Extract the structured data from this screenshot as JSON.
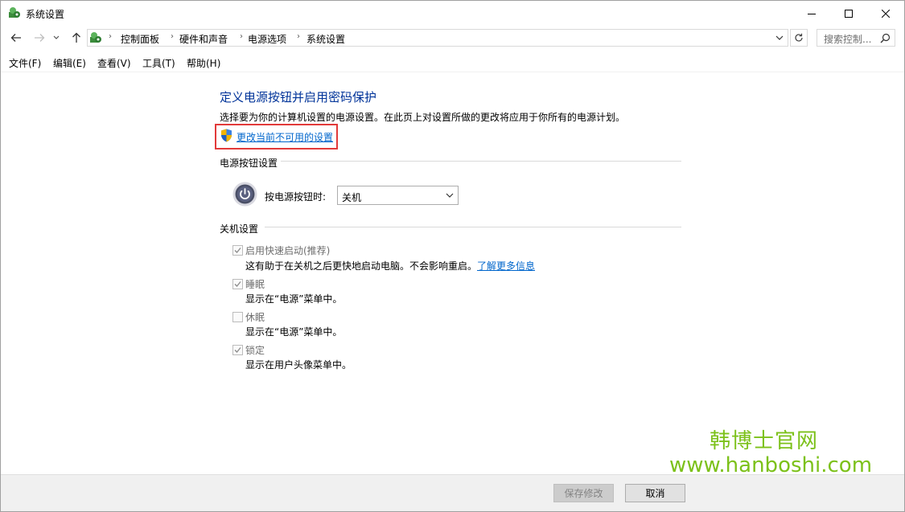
{
  "window": {
    "title": "系统设置"
  },
  "breadcrumb": [
    "控制面板",
    "硬件和声音",
    "电源选项",
    "系统设置"
  ],
  "search": {
    "placeholder": "搜索控制..."
  },
  "menu": [
    "文件(F)",
    "编辑(E)",
    "查看(V)",
    "工具(T)",
    "帮助(H)"
  ],
  "main": {
    "heading": "定义电源按钮并启用密码保护",
    "description": "选择要为你的计算机设置的电源设置。在此页上对设置所做的更改将应用于你所有的电源计划。",
    "change_link": "更改当前不可用的设置",
    "power_section": "电源按钮设置",
    "power_label": "按电源按钮时:",
    "power_value": "关机",
    "shutdown_section": "关机设置",
    "options": [
      {
        "label": "启用快速启动(推荐)",
        "desc": "这有助于在关机之后更快地启动电脑。不会影响重启。",
        "checked": true,
        "link": "了解更多信息"
      },
      {
        "label": "睡眠",
        "desc": "显示在“电源”菜单中。",
        "checked": true
      },
      {
        "label": "休眠",
        "desc": "显示在“电源”菜单中。",
        "checked": false
      },
      {
        "label": "锁定",
        "desc": "显示在用户头像菜单中。",
        "checked": true
      }
    ]
  },
  "watermark": {
    "name": "韩博士官网",
    "url": "www.hanboshi.com"
  },
  "footer": {
    "save": "保存修改",
    "cancel": "取消"
  },
  "colors": {
    "heading": "#003399",
    "link": "#0066cc",
    "highlight": "#e23a3a",
    "watermark": "#7cc11a"
  }
}
